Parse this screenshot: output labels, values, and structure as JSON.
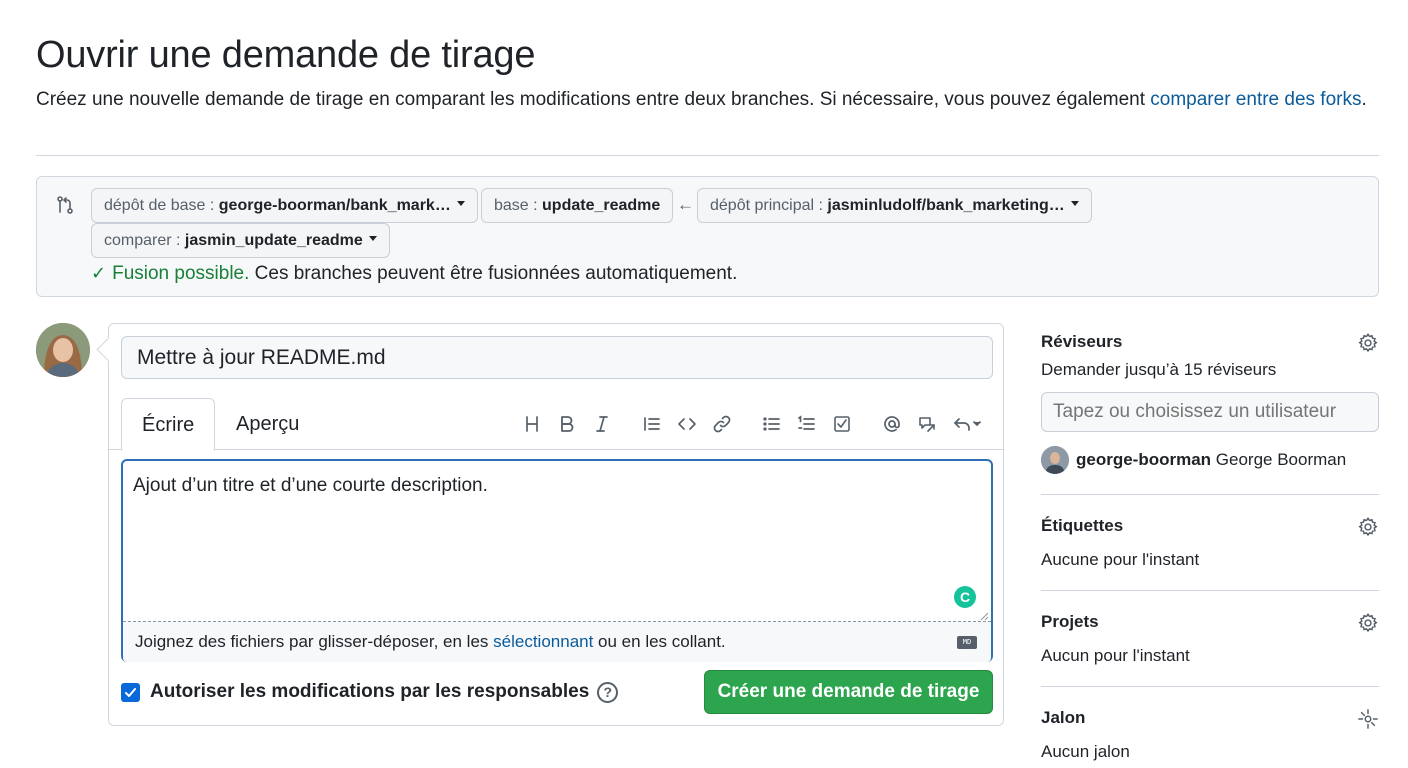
{
  "header": {
    "title": "Ouvrir une demande de tirage",
    "description": "Créez une nouvelle demande de tirage en comparant les modifications entre deux branches. Si nécessaire, vous pouvez également ",
    "description_link": "comparer entre des forks",
    "description_end": "."
  },
  "compare": {
    "base_repo_label": "dépôt de base : ",
    "base_repo_value": "george-boorman/bank_mark…",
    "base_label": "base : ",
    "base_value": "update_readme",
    "arrow": "←",
    "head_repo_label": "dépôt principal : ",
    "head_repo_value": "jasminludolf/bank_marketing…",
    "compare_label": "comparer : ",
    "compare_value": "jasmin_update_readme",
    "merge_ok": "Fusion possible.",
    "merge_text": " Ces branches peuvent être fusionnées automatiquement."
  },
  "form": {
    "title_value": "Mettre à jour README.md",
    "tab_write": "Écrire",
    "tab_preview": "Aperçu",
    "body_text": "Ajout d’un titre et d’une courte description.",
    "attach_prefix": "Joignez des fichiers par glisser-déposer, en les ",
    "attach_link": "sélectionnant",
    "attach_suffix": " ou en les collant.",
    "md_badge": "MD",
    "allow_edits_label": "Autoriser les modifications par les responsables",
    "allow_edits_checked": true,
    "help": "?",
    "create_button": "Créer une demande de tirage",
    "grammarly": "C"
  },
  "toolbar_icons": [
    "heading-icon",
    "bold-icon",
    "italic-icon",
    "quote-icon",
    "code-icon",
    "link-icon",
    "bulleted-list-icon",
    "numbered-list-icon",
    "task-list-icon",
    "mention-icon",
    "reference-icon",
    "undo-icon"
  ],
  "sidebar": {
    "reviewers_title": "Réviseurs",
    "reviewers_sub": "Demander jusqu’à 15 réviseurs",
    "reviewers_placeholder": "Tapez ou choisissez un utilisateur",
    "reviewer_login": "george-boorman",
    "reviewer_name": "George Boorman",
    "labels_title": "Étiquettes",
    "labels_sub": "Aucune pour l'instant",
    "projects_title": "Projets",
    "projects_sub": "Aucun pour l'instant",
    "milestone_title": "Jalon",
    "milestone_sub": "Aucun jalon"
  },
  "colors": {
    "accent_blue": "#0969da",
    "link_blue": "#0b5b9a",
    "success_green": "#1a7f37",
    "button_green": "#2da44e"
  }
}
